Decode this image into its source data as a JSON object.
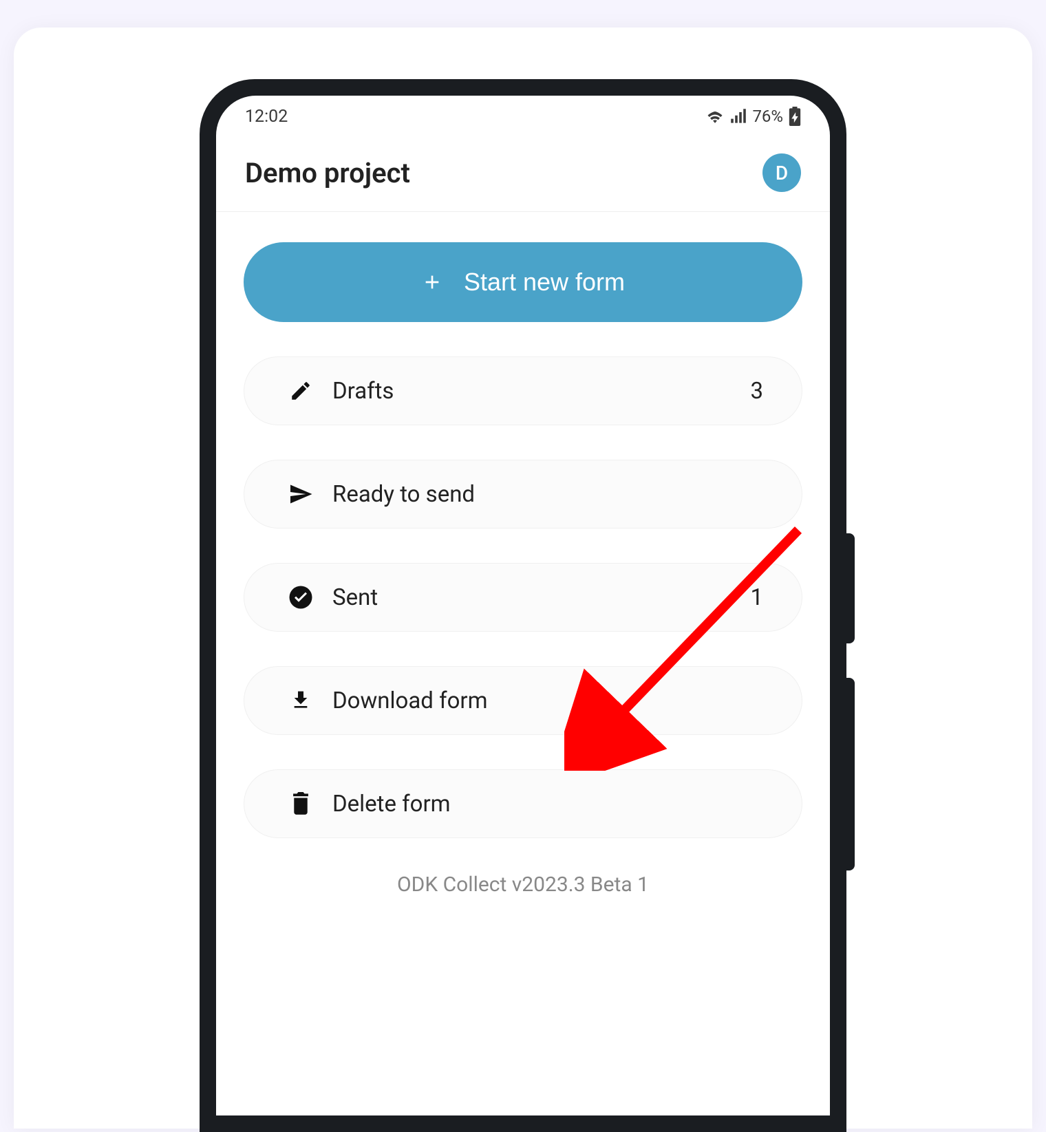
{
  "status_bar": {
    "time": "12:02",
    "battery_text": "76%"
  },
  "app_bar": {
    "title": "Demo project",
    "avatar_letter": "D"
  },
  "primary_button": {
    "label": "Start new form"
  },
  "menu": {
    "drafts": {
      "label": "Drafts",
      "count": "3"
    },
    "ready": {
      "label": "Ready to send",
      "count": ""
    },
    "sent": {
      "label": "Sent",
      "count": "1"
    },
    "download": {
      "label": "Download form",
      "count": ""
    },
    "delete": {
      "label": "Delete form",
      "count": ""
    }
  },
  "footer": {
    "version": "ODK Collect v2023.3 Beta 1"
  },
  "colors": {
    "accent": "#4aa3c9",
    "arrow": "#ff0000"
  }
}
